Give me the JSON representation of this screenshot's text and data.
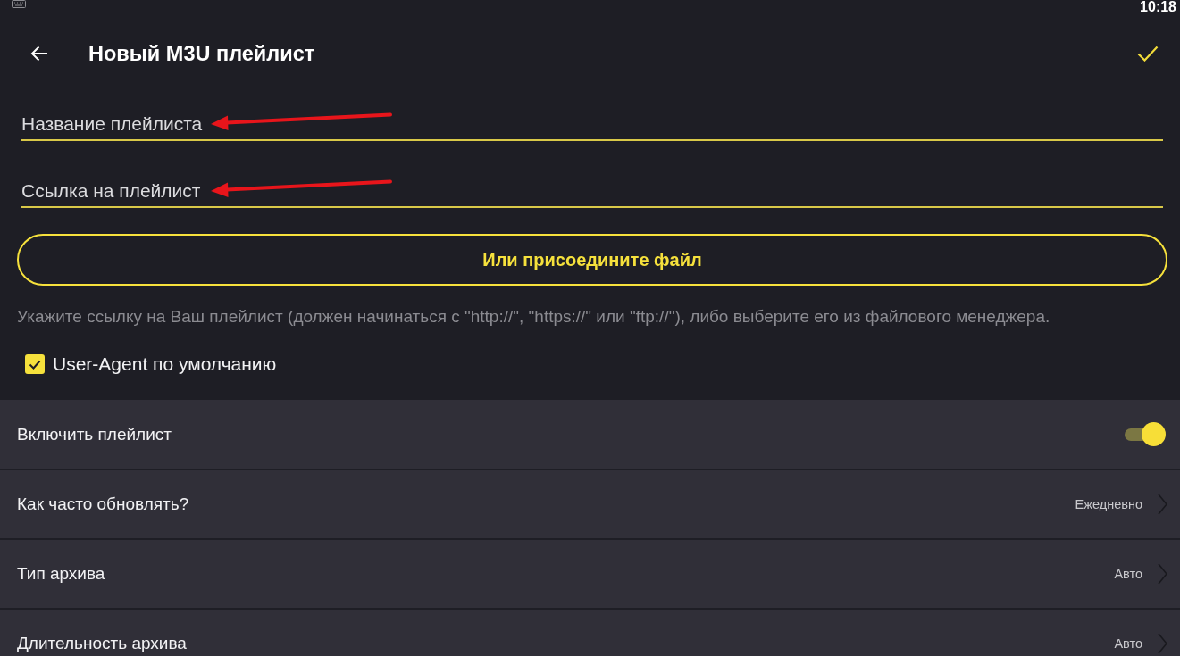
{
  "status_bar": {
    "time": "10:18"
  },
  "header": {
    "title": "Новый M3U плейлист"
  },
  "fields": [
    {
      "placeholder": "Название плейлиста",
      "arrow": true
    },
    {
      "placeholder": "Ссылка на плейлист",
      "arrow": true
    }
  ],
  "attach_button": {
    "label": "Или присоедините файл"
  },
  "hint": "Укажите ссылку на Ваш плейлист (должен начинаться с \"http://\", \"https://\" или \"ftp://\"), либо выберите его из файлового менеджера.",
  "user_agent": {
    "label": "User-Agent по умолчанию",
    "checked": true
  },
  "settings": [
    {
      "kind": "switch",
      "label": "Включить плейлист",
      "on": true
    },
    {
      "kind": "choice",
      "label": "Как часто обновлять?",
      "value": "Ежедневно"
    },
    {
      "kind": "choice",
      "label": "Тип архива",
      "value": "Авто"
    },
    {
      "kind": "choice",
      "label": "Длительность архива",
      "value": "Авто"
    }
  ]
}
